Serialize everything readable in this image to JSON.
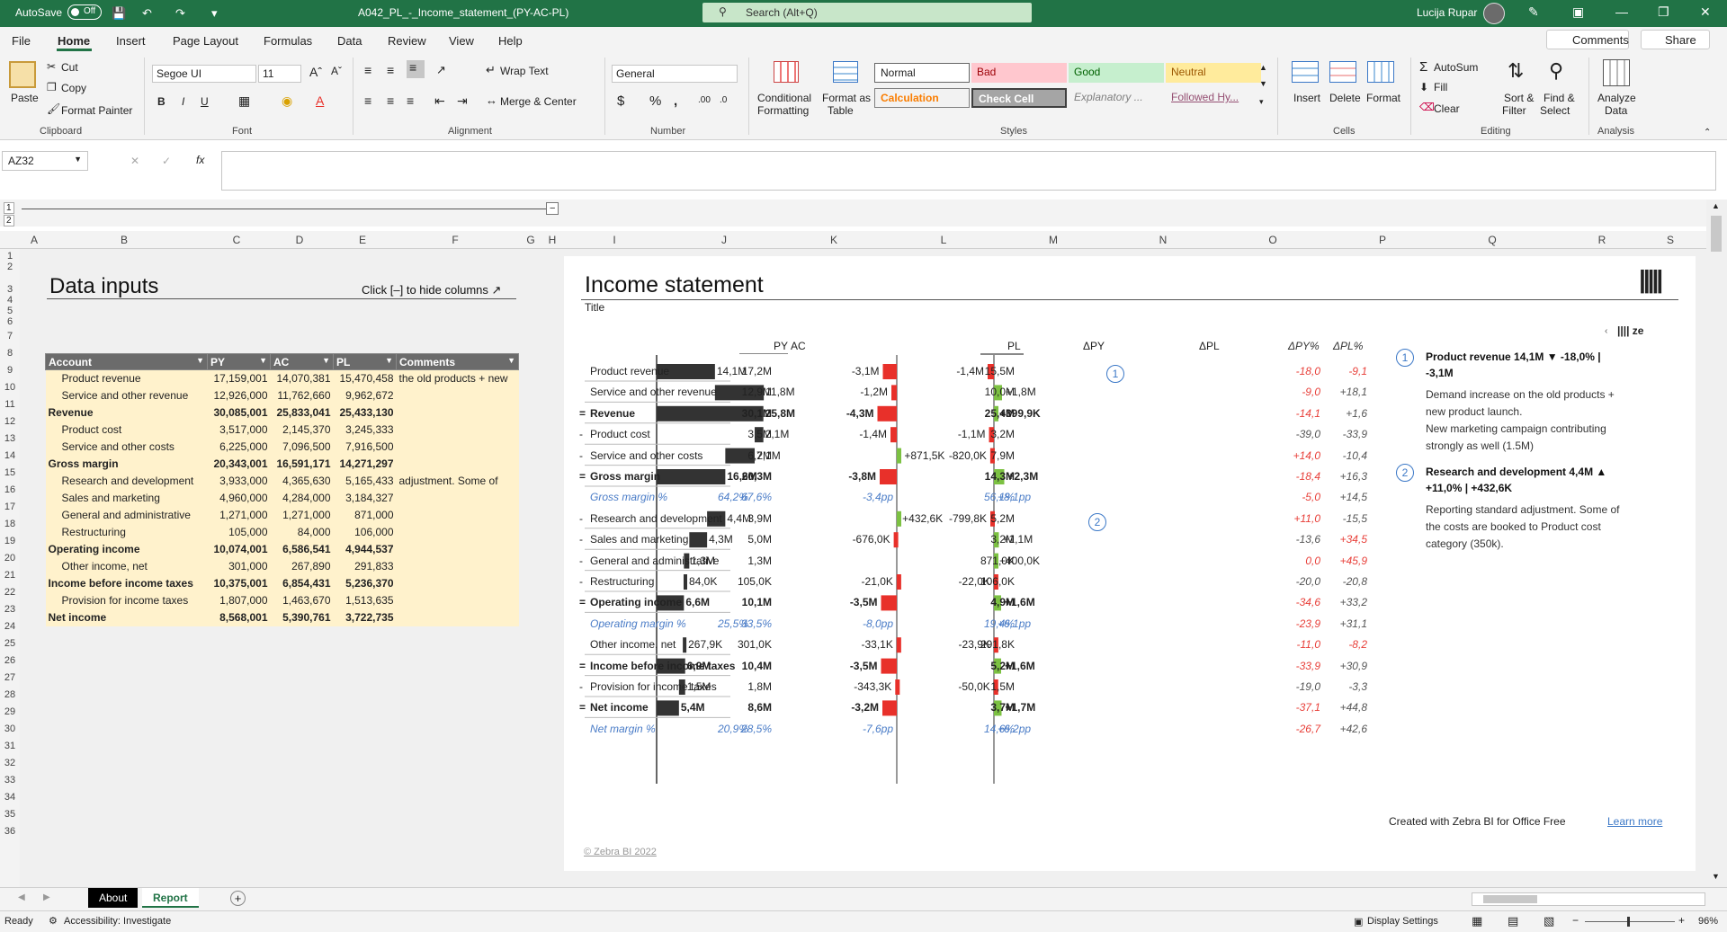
{
  "titlebar": {
    "autosave_label": "AutoSave",
    "autosave_state": "Off",
    "doc_title": "A042_PL_-_Income_statement_(PY-AC-PL)",
    "search_placeholder": "Search (Alt+Q)",
    "user_name": "Lucija Rupar"
  },
  "menu": {
    "items": [
      "File",
      "Home",
      "Insert",
      "Page Layout",
      "Formulas",
      "Data",
      "Review",
      "View",
      "Help"
    ],
    "active": "Home",
    "comments_label": "Comments",
    "share_label": "Share"
  },
  "ribbon": {
    "clipboard": {
      "paste": "Paste",
      "cut": "Cut",
      "copy": "Copy",
      "format_painter": "Format Painter",
      "group": "Clipboard"
    },
    "font": {
      "family": "Segoe UI",
      "size": "11",
      "bold": "B",
      "italic": "I",
      "underline": "U",
      "group": "Font"
    },
    "alignment": {
      "wrap_text": "Wrap Text",
      "merge_center": "Merge & Center",
      "group": "Alignment"
    },
    "number": {
      "format": "General",
      "group": "Number"
    },
    "styles": {
      "conditional": "Conditional",
      "conditional2": "Formatting",
      "format_as": "Format as",
      "format_as2": "Table",
      "normal": "Normal",
      "bad": "Bad",
      "good": "Good",
      "neutral": "Neutral",
      "calculation": "Calculation",
      "check_cell": "Check Cell",
      "explanatory": "Explanatory ...",
      "followed": "Followed Hy...",
      "group": "Styles"
    },
    "cells": {
      "insert": "Insert",
      "delete": "Delete",
      "format": "Format",
      "group": "Cells"
    },
    "editing": {
      "autosum": "AutoSum",
      "fill": "Fill",
      "clear": "Clear",
      "sort": "Sort &",
      "sort2": "Filter",
      "find": "Find &",
      "find2": "Select",
      "group": "Editing"
    },
    "analysis": {
      "analyze": "Analyze",
      "analyze2": "Data",
      "group": "Analysis"
    }
  },
  "formula_bar": {
    "name_box": "AZ32",
    "fx": "fx",
    "value": ""
  },
  "columns": [
    "A",
    "B",
    "C",
    "D",
    "E",
    "F",
    "G",
    "H",
    "I",
    "J",
    "K",
    "L",
    "M",
    "N",
    "O",
    "P",
    "Q",
    "R",
    "S"
  ],
  "rows": [
    "1",
    "2",
    "3",
    "4",
    "5",
    "6",
    "7",
    "8",
    "9",
    "10",
    "11",
    "12",
    "13",
    "14",
    "15",
    "16",
    "17",
    "18",
    "19",
    "20",
    "21",
    "22",
    "23",
    "24",
    "25",
    "26",
    "27",
    "28",
    "29",
    "30",
    "31",
    "32",
    "33",
    "34",
    "35",
    "36"
  ],
  "data_inputs": {
    "title": "Data inputs",
    "hint": "Click [–] to hide columns ↗",
    "headers": [
      "Account",
      "PY",
      "AC",
      "PL",
      "Comments"
    ],
    "rows": [
      {
        "account": "Product revenue",
        "py": "17,159,001",
        "ac": "14,070,381",
        "pl": "15,470,458",
        "comment": "the old products + new",
        "bold": false
      },
      {
        "account": "Service and other revenue",
        "py": "12,926,000",
        "ac": "11,762,660",
        "pl": "9,962,672",
        "comment": "",
        "bold": false
      },
      {
        "account": "Revenue",
        "py": "30,085,001",
        "ac": "25,833,041",
        "pl": "25,433,130",
        "comment": "",
        "bold": true
      },
      {
        "account": "Product cost",
        "py": "3,517,000",
        "ac": "2,145,370",
        "pl": "3,245,333",
        "comment": "",
        "bold": false
      },
      {
        "account": "Service and other costs",
        "py": "6,225,000",
        "ac": "7,096,500",
        "pl": "7,916,500",
        "comment": "",
        "bold": false
      },
      {
        "account": "Gross margin",
        "py": "20,343,001",
        "ac": "16,591,171",
        "pl": "14,271,297",
        "comment": "",
        "bold": true
      },
      {
        "account": "Research and development",
        "py": "3,933,000",
        "ac": "4,365,630",
        "pl": "5,165,433",
        "comment": "adjustment. Some of",
        "bold": false
      },
      {
        "account": "Sales and marketing",
        "py": "4,960,000",
        "ac": "4,284,000",
        "pl": "3,184,327",
        "comment": "",
        "bold": false
      },
      {
        "account": "General and administrative",
        "py": "1,271,000",
        "ac": "1,271,000",
        "pl": "871,000",
        "comment": "",
        "bold": false
      },
      {
        "account": "Restructuring",
        "py": "105,000",
        "ac": "84,000",
        "pl": "106,000",
        "comment": "",
        "bold": false
      },
      {
        "account": "Operating income",
        "py": "10,074,001",
        "ac": "6,586,541",
        "pl": "4,944,537",
        "comment": "",
        "bold": true
      },
      {
        "account": "Other income, net",
        "py": "301,000",
        "ac": "267,890",
        "pl": "291,833",
        "comment": "",
        "bold": false
      },
      {
        "account": "Income before income taxes",
        "py": "10,375,001",
        "ac": "6,854,431",
        "pl": "5,236,370",
        "comment": "",
        "bold": true
      },
      {
        "account": "Provision for income taxes",
        "py": "1,807,000",
        "ac": "1,463,670",
        "pl": "1,513,635",
        "comment": "",
        "bold": false
      },
      {
        "account": "Net income",
        "py": "8,568,001",
        "ac": "5,390,761",
        "pl": "3,722,735",
        "comment": "",
        "bold": true
      }
    ]
  },
  "report": {
    "title": "Income statement",
    "subtitle": "Title",
    "headers": {
      "py": "PY",
      "ac": "AC",
      "pl": "PL",
      "dpy": "ΔPY",
      "dpl": "ΔPL",
      "dpy_pct": "ΔPY%",
      "dpl_pct": "ΔPL%"
    },
    "rows": [
      {
        "label": "Product revenue",
        "prefix": "",
        "style": "n",
        "py": "17,2M",
        "ac": "14,1M",
        "pl": "15,5M",
        "dpy": "-3,1M",
        "dpl": "-1,4M",
        "dpy_pct": "-18,0",
        "dpl_pct": "-9,1",
        "ac_v": 14.1,
        "dpy_v": -3.1,
        "dpl_v": -1.4,
        "dpy_pct_neg": true,
        "dpl_pct_neg": true
      },
      {
        "label": "Service and other revenue",
        "prefix": "",
        "style": "n",
        "py": "12,9M",
        "ac": "11,8M",
        "pl": "10,0M",
        "dpy": "-1,2M",
        "dpl": "+1,8M",
        "dpy_pct": "-9,0",
        "dpl_pct": "+18,1",
        "ac_v": 11.8,
        "dpy_v": -1.2,
        "dpl_v": 1.8,
        "dpy_pct_neg": true,
        "dpl_pct_neg": false
      },
      {
        "label": "Revenue",
        "prefix": "=",
        "style": "b",
        "py": "30,1M",
        "ac": "25,8M",
        "pl": "25,4M",
        "dpy": "-4,3M",
        "dpl": "+399,9K",
        "dpy_pct": "-14,1",
        "dpl_pct": "+1,6",
        "ac_v": 25.8,
        "dpy_v": -4.3,
        "dpl_v": 0.4,
        "dpy_pct_neg": true,
        "dpl_pct_neg": false
      },
      {
        "label": "Product cost",
        "prefix": "-",
        "style": "n",
        "py": "3,5M",
        "ac": "2,1M",
        "pl": "3,2M",
        "dpy": "-1,4M",
        "dpl": "-1,1M",
        "dpy_pct": "-39,0",
        "dpl_pct": "-33,9",
        "ac_v": 2.1,
        "dpy_v": -1.4,
        "dpl_v": -1.1,
        "dpy_pct_neg": false,
        "dpl_pct_neg": false
      },
      {
        "label": "Service and other costs",
        "prefix": "-",
        "style": "n",
        "py": "6,2M",
        "ac": "7,1M",
        "pl": "7,9M",
        "dpy": "+871,5K",
        "dpl": "-820,0K",
        "dpy_pct": "+14,0",
        "dpl_pct": "-10,4",
        "ac_v": 7.1,
        "dpy_v": 0.87,
        "dpl_v": -0.82,
        "dpy_pct_neg": true,
        "dpl_pct_neg": false
      },
      {
        "label": "Gross margin",
        "prefix": "=",
        "style": "b",
        "py": "20,3M",
        "ac": "16,6M",
        "pl": "14,3M",
        "dpy": "-3,8M",
        "dpl": "+2,3M",
        "dpy_pct": "-18,4",
        "dpl_pct": "+16,3",
        "ac_v": 16.6,
        "dpy_v": -3.8,
        "dpl_v": 2.3,
        "dpy_pct_neg": true,
        "dpl_pct_neg": false
      },
      {
        "label": "Gross margin %",
        "prefix": "",
        "style": "i",
        "py": "67,6%",
        "ac": "64,2%",
        "pl": "56,1%",
        "dpy": "-3,4pp",
        "dpl": "+8,1pp",
        "dpy_pct": "-5,0",
        "dpl_pct": "+14,5",
        "ac_v": 0,
        "dpy_v": 0,
        "dpl_v": 0,
        "dpy_pct_neg": true,
        "dpl_pct_neg": false
      },
      {
        "label": "Research and development",
        "prefix": "-",
        "style": "n",
        "py": "3,9M",
        "ac": "4,4M",
        "pl": "5,2M",
        "dpy": "+432,6K",
        "dpl": "-799,8K",
        "dpy_pct": "+11,0",
        "dpl_pct": "-15,5",
        "ac_v": 4.4,
        "dpy_v": 0.43,
        "dpl_v": -0.8,
        "dpy_pct_neg": true,
        "dpl_pct_neg": false
      },
      {
        "label": "Sales and marketing",
        "prefix": "-",
        "style": "n",
        "py": "5,0M",
        "ac": "4,3M",
        "pl": "3,2M",
        "dpy": "-676,0K",
        "dpl": "+1,1M",
        "dpy_pct": "-13,6",
        "dpl_pct": "+34,5",
        "ac_v": 4.3,
        "dpy_v": -0.68,
        "dpl_v": 1.1,
        "dpy_pct_neg": false,
        "dpl_pct_neg": true
      },
      {
        "label": "General and administrative",
        "prefix": "-",
        "style": "n",
        "py": "1,3M",
        "ac": "1,3M",
        "pl": "871,0K",
        "dpy": "",
        "dpl": "+400,0K",
        "dpy_pct": "0,0",
        "dpl_pct": "+45,9",
        "ac_v": 1.3,
        "dpy_v": 0,
        "dpl_v": 0.4,
        "dpy_pct_neg": true,
        "dpl_pct_neg": true
      },
      {
        "label": "Restructuring",
        "prefix": "-",
        "style": "n",
        "py": "105,0K",
        "ac": "84,0K",
        "pl": "106,0K",
        "dpy": "-21,0K",
        "dpl": "-22,0K",
        "dpy_pct": "-20,0",
        "dpl_pct": "-20,8",
        "ac_v": 0.08,
        "dpy_v": -0.02,
        "dpl_v": -0.02,
        "dpy_pct_neg": false,
        "dpl_pct_neg": false
      },
      {
        "label": "Operating income",
        "prefix": "=",
        "style": "b",
        "py": "10,1M",
        "ac": "6,6M",
        "pl": "4,9M",
        "dpy": "-3,5M",
        "dpl": "+1,6M",
        "dpy_pct": "-34,6",
        "dpl_pct": "+33,2",
        "ac_v": 6.6,
        "dpy_v": -3.5,
        "dpl_v": 1.6,
        "dpy_pct_neg": true,
        "dpl_pct_neg": false
      },
      {
        "label": "Operating margin %",
        "prefix": "",
        "style": "i",
        "py": "33,5%",
        "ac": "25,5%",
        "pl": "19,4%",
        "dpy": "-8,0pp",
        "dpl": "+6,1pp",
        "dpy_pct": "-23,9",
        "dpl_pct": "+31,1",
        "ac_v": 0,
        "dpy_v": 0,
        "dpl_v": 0,
        "dpy_pct_neg": true,
        "dpl_pct_neg": false
      },
      {
        "label": "Other income, net",
        "prefix": "",
        "style": "n",
        "py": "301,0K",
        "ac": "267,9K",
        "pl": "291,8K",
        "dpy": "-33,1K",
        "dpl": "-23,9K",
        "dpy_pct": "-11,0",
        "dpl_pct": "-8,2",
        "ac_v": 0.27,
        "dpy_v": -0.03,
        "dpl_v": -0.02,
        "dpy_pct_neg": true,
        "dpl_pct_neg": true
      },
      {
        "label": "Income before income taxes",
        "prefix": "=",
        "style": "b",
        "py": "10,4M",
        "ac": "6,9M",
        "pl": "5,2M",
        "dpy": "-3,5M",
        "dpl": "+1,6M",
        "dpy_pct": "-33,9",
        "dpl_pct": "+30,9",
        "ac_v": 6.9,
        "dpy_v": -3.5,
        "dpl_v": 1.6,
        "dpy_pct_neg": true,
        "dpl_pct_neg": false
      },
      {
        "label": "Provision for income taxes",
        "prefix": "-",
        "style": "n",
        "py": "1,8M",
        "ac": "1,5M",
        "pl": "1,5M",
        "dpy": "-343,3K",
        "dpl": "-50,0K",
        "dpy_pct": "-19,0",
        "dpl_pct": "-3,3",
        "ac_v": 1.5,
        "dpy_v": -0.34,
        "dpl_v": -0.05,
        "dpy_pct_neg": false,
        "dpl_pct_neg": false
      },
      {
        "label": "Net income",
        "prefix": "=",
        "style": "b",
        "py": "8,6M",
        "ac": "5,4M",
        "pl": "3,7M",
        "dpy": "-3,2M",
        "dpl": "+1,7M",
        "dpy_pct": "-37,1",
        "dpl_pct": "+44,8",
        "ac_v": 5.4,
        "dpy_v": -3.2,
        "dpl_v": 1.7,
        "dpy_pct_neg": true,
        "dpl_pct_neg": false
      },
      {
        "label": "Net margin %",
        "prefix": "",
        "style": "i",
        "py": "28,5%",
        "ac": "20,9%",
        "pl": "14,6%",
        "dpy": "-7,6pp",
        "dpl": "+6,2pp",
        "dpy_pct": "-26,7",
        "dpl_pct": "+42,6",
        "ac_v": 0,
        "dpy_v": 0,
        "dpl_v": 0,
        "dpy_pct_neg": true,
        "dpl_pct_neg": false
      }
    ],
    "notes": [
      {
        "num": "1",
        "head1": "Product revenue 14,1M ▼ -18,0% |",
        "head2": "-3,1M",
        "text": [
          "Demand increase on the old products +",
          "new product launch.",
          "New marketing campaign contributing",
          "strongly as well (1.5M)"
        ]
      },
      {
        "num": "2",
        "head1": "Research and development 4,4M ▲",
        "head2": "+11,0% | +432,6K",
        "text": [
          "Reporting standard adjustment. Some of",
          "the costs are booked to Product cost",
          "category (350k)."
        ]
      }
    ],
    "footer_credit": "Created with Zebra BI for Office Free",
    "footer_link": "Learn more",
    "copyright": "© Zebra BI 2022",
    "colors": {
      "bar": "#333333",
      "neg": "#e8302a",
      "pos": "#7cc142",
      "note": "#3b78c7"
    }
  },
  "sheet_tabs": {
    "tabs": [
      "About",
      "Report"
    ],
    "active": "Report"
  },
  "status": {
    "ready": "Ready",
    "accessibility": "Accessibility: Investigate",
    "display_settings": "Display Settings",
    "zoom": "96%"
  }
}
